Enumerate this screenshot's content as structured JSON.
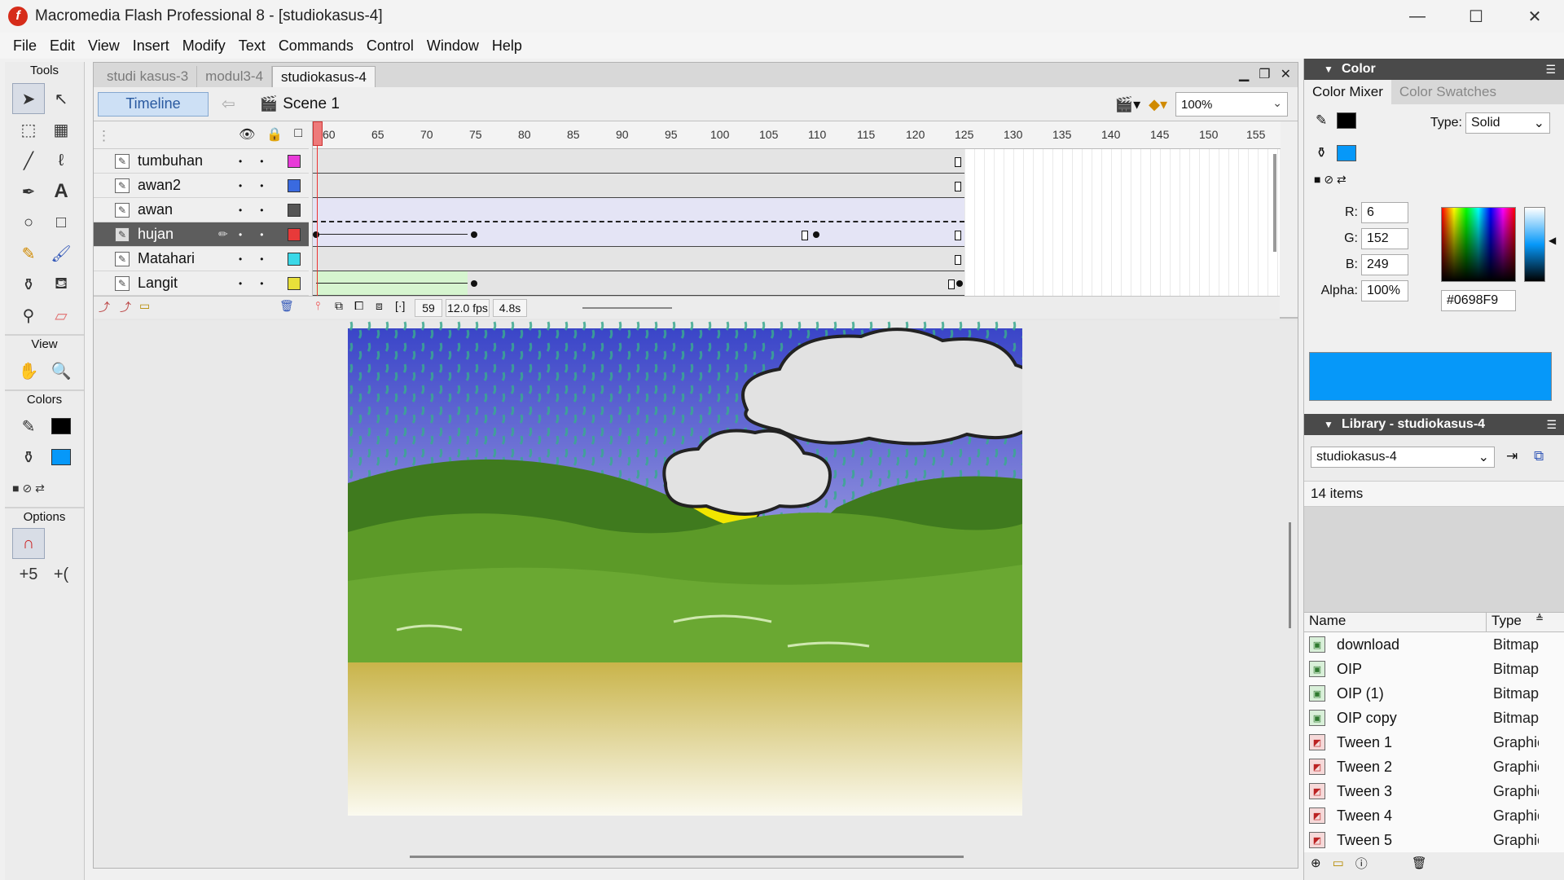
{
  "window": {
    "title": "Macromedia Flash Professional 8 - [studiokasus-4]",
    "app_icon_glyph": "f",
    "controls": {
      "minimize": "—",
      "maximize": "☐",
      "close": "✕"
    }
  },
  "menu": [
    "File",
    "Edit",
    "View",
    "Insert",
    "Modify",
    "Text",
    "Commands",
    "Control",
    "Window",
    "Help"
  ],
  "tools": {
    "title": "Tools",
    "view_label": "View",
    "colors_label": "Colors",
    "options_label": "Options",
    "stroke_color": "#000000",
    "fill_color": "#0698F9"
  },
  "doc_tabs": [
    "studi kasus-3",
    "modul3-4",
    "studiokasus-4"
  ],
  "edit_bar": {
    "timeline_label": "Timeline",
    "scene_label": "Scene 1",
    "zoom": "100%"
  },
  "timeline": {
    "ruler_ticks": [
      "60",
      "65",
      "70",
      "75",
      "80",
      "85",
      "90",
      "95",
      "100",
      "105",
      "110",
      "115",
      "120",
      "125",
      "130",
      "135",
      "140",
      "145",
      "150",
      "155"
    ],
    "layers": [
      {
        "name": "tumbuhan",
        "color": "#e83ad8",
        "selected": false
      },
      {
        "name": "awan2",
        "color": "#3a6ae0",
        "selected": false
      },
      {
        "name": "awan",
        "color": "#555555",
        "selected": false
      },
      {
        "name": "hujan",
        "color": "#e83a3a",
        "selected": true
      },
      {
        "name": "Matahari",
        "color": "#3ad8e8",
        "selected": false
      },
      {
        "name": "Langit",
        "color": "#e8e03a",
        "selected": false
      }
    ],
    "current_frame": "59",
    "fps": "12.0 fps",
    "elapsed": "4.8s"
  },
  "color_panel": {
    "title": "Color",
    "tabs": [
      "Color Mixer",
      "Color Swatches"
    ],
    "type_label": "Type:",
    "type_value": "Solid",
    "r_label": "R:",
    "r": "6",
    "g_label": "G:",
    "g": "152",
    "b_label": "B:",
    "b": "249",
    "alpha_label": "Alpha:",
    "alpha": "100%",
    "hex": "#0698F9"
  },
  "library": {
    "title": "Library - studiokasus-4",
    "doc_select": "studiokasus-4",
    "count": "14 items",
    "col_name": "Name",
    "col_type": "Type",
    "items": [
      {
        "name": "download",
        "type": "Bitmap",
        "kind": "bmp"
      },
      {
        "name": "OIP",
        "type": "Bitmap",
        "kind": "bmp"
      },
      {
        "name": "OIP (1)",
        "type": "Bitmap",
        "kind": "bmp"
      },
      {
        "name": "OIP copy",
        "type": "Bitmap",
        "kind": "bmp"
      },
      {
        "name": "Tween 1",
        "type": "Graphic",
        "kind": "gr"
      },
      {
        "name": "Tween 2",
        "type": "Graphic",
        "kind": "gr"
      },
      {
        "name": "Tween 3",
        "type": "Graphic",
        "kind": "gr"
      },
      {
        "name": "Tween 4",
        "type": "Graphic",
        "kind": "gr"
      },
      {
        "name": "Tween 5",
        "type": "Graphic",
        "kind": "gr"
      }
    ]
  }
}
